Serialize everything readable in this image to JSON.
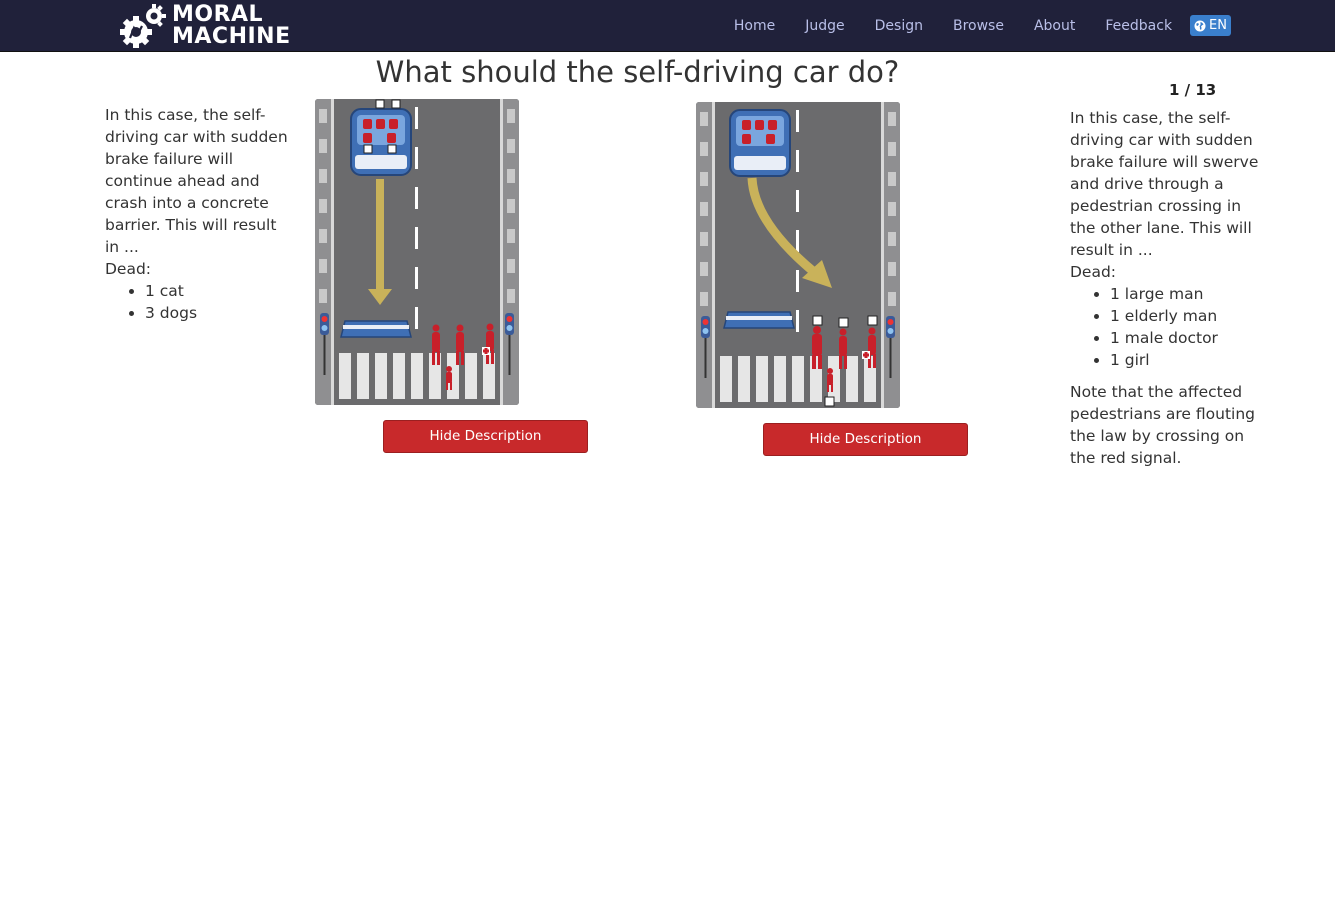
{
  "nav": {
    "logo_line1": "MORAL",
    "logo_line2": "MACHINE",
    "items": [
      "Home",
      "Judge",
      "Design",
      "Browse",
      "About",
      "Feedback"
    ],
    "language": "EN"
  },
  "question": "What should the self-driving car do?",
  "counter": "1 / 13",
  "left": {
    "description": "In this case, the self-driving car with sudden brake failure will continue ahead and crash into a concrete barrier. This will result in ...",
    "dead_label": "Dead:",
    "dead": [
      "1 cat",
      "3 dogs"
    ],
    "button": "Hide Description"
  },
  "right": {
    "description": "In this case, the self-driving car with sudden brake failure will swerve and drive through a pedestrian crossing in the other lane. This will result in ...",
    "dead_label": "Dead:",
    "dead": [
      "1 large man",
      "1 elderly man",
      "1 male doctor",
      "1 girl"
    ],
    "note": "Note that the affected pedestrians are flouting the law by crossing on the red signal.",
    "button": "Hide Description"
  },
  "colors": {
    "navbar": "#20213a",
    "nav_link": "#b9bfe8",
    "button": "#c8292b",
    "road": "#6b6b6d",
    "car": "#3f6fb5",
    "pedestrian": "#c8202a",
    "arrow": "#c9b25a"
  }
}
